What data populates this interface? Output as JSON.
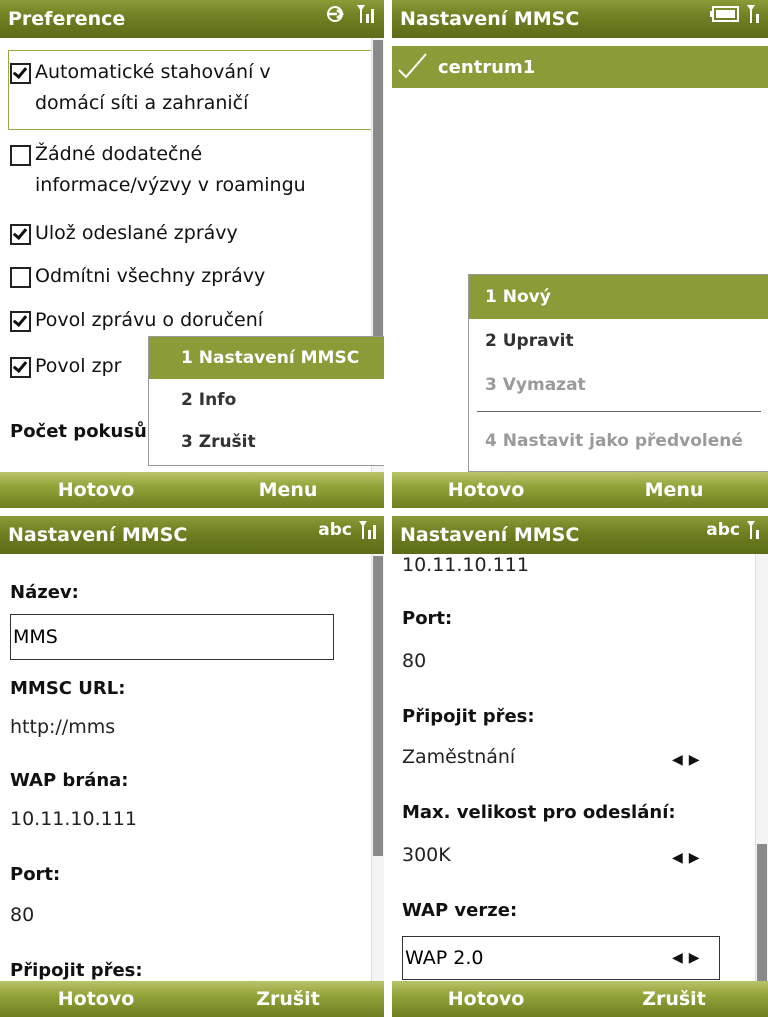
{
  "colors": {
    "accent": "#8a9b38",
    "titlebar": "#6f7f22"
  },
  "p1": {
    "title": "Preference",
    "items": [
      {
        "label_lines": [
          "Automatické stahování v",
          "domácí síti a zahraničí"
        ],
        "checked": true
      },
      {
        "label_lines": [
          "Žádné dodatečné",
          "informace/výzvy v roamingu"
        ],
        "checked": false
      },
      {
        "label_lines": [
          "Ulož odeslané zprávy"
        ],
        "checked": true
      },
      {
        "label_lines": [
          "Odmítni všechny zprávy"
        ],
        "checked": false
      },
      {
        "label_lines": [
          "Povol zprávu o doručení"
        ],
        "checked": true
      },
      {
        "label_lines": [
          "Povol zpr"
        ],
        "checked": true
      }
    ],
    "bottom_label": "Počet pokusů",
    "menu": [
      "1 Nastavení MMSC",
      "2 Info",
      "3 Zrušit"
    ],
    "soft_left": "Hotovo",
    "soft_right": "Menu"
  },
  "p2": {
    "title": "Nastavení MMSC",
    "list_item": "centrum1",
    "menu": [
      "1 Nový",
      "2 Upravit",
      "3 Vymazat",
      "4 Nastavit jako předvolené"
    ],
    "soft_left": "Hotovo",
    "soft_right": "Menu"
  },
  "p3": {
    "title": "Nastavení MMSC",
    "input_mode": "abc",
    "name_label": "Název:",
    "name_value": "MMS",
    "url_label": "MMSC URL:",
    "url_value": "http://mms",
    "wap_label": "WAP brána:",
    "wap_value": "10.11.10.111",
    "port_label": "Port:",
    "port_value": "80",
    "connect_label": "Připojit přes:",
    "soft_left": "Hotovo",
    "soft_right": "Zrušit"
  },
  "p4": {
    "title": "Nastavení MMSC",
    "input_mode": "abc",
    "wap_value": "10.11.10.111",
    "port_label": "Port:",
    "port_value": "80",
    "connect_label": "Připojit přes:",
    "connect_value": "Zaměstnání",
    "max_label": "Max. velikost pro odeslání:",
    "max_value": "300K",
    "wapver_label": "WAP verze:",
    "wapver_value": "WAP 2.0",
    "soft_left": "Hotovo",
    "soft_right": "Zrušit"
  }
}
